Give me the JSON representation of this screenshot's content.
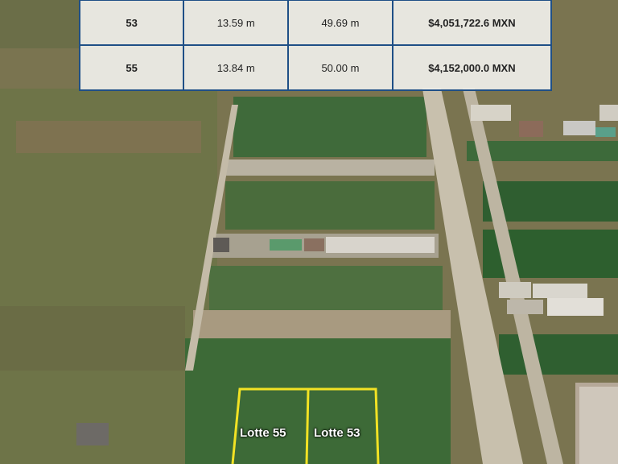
{
  "table": {
    "rows": [
      {
        "lot": "53",
        "front": "13.59 m",
        "depth": "49.69 m",
        "price": "$4,051,722.6 MXN"
      },
      {
        "lot": "55",
        "front": "13.84 m",
        "depth": "50.00 m",
        "price": "$4,152,000.0 MXN"
      }
    ]
  },
  "map": {
    "lot_labels": [
      "Lotte 55",
      "Lotte 53"
    ],
    "highlight_color": "#f2e224",
    "table_border_color": "#1f4f86"
  }
}
